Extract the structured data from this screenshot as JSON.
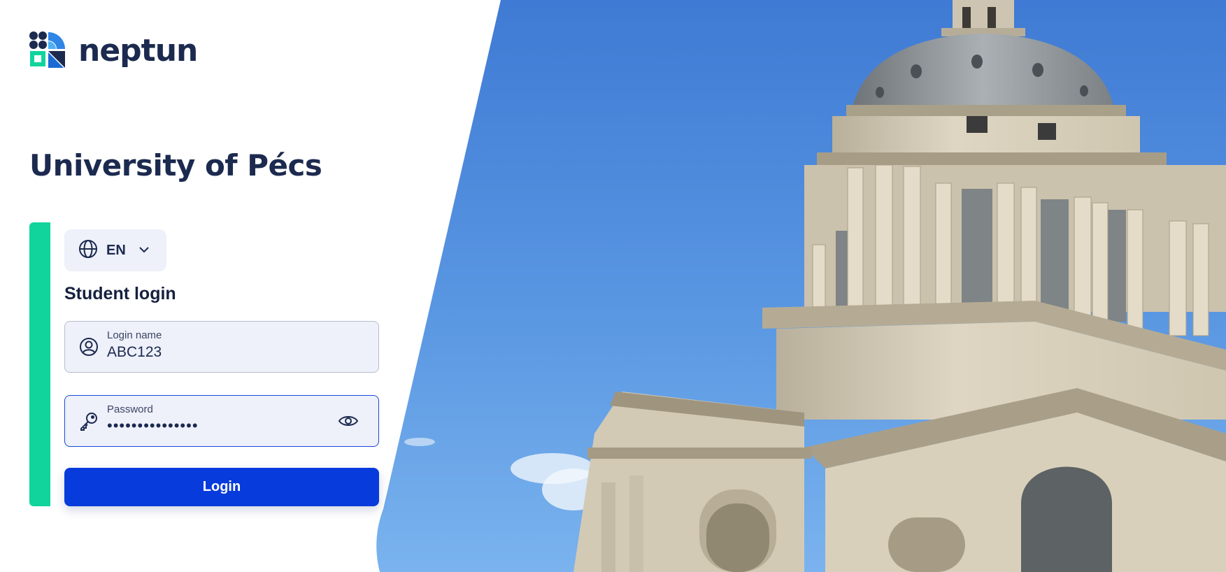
{
  "brand": {
    "name": "neptun"
  },
  "institution": {
    "title": "University of Pécs"
  },
  "language": {
    "code": "EN",
    "icon": "globe-icon",
    "dropdown_icon": "chevron-down-icon"
  },
  "login_form": {
    "title": "Student login",
    "login_name": {
      "label": "Login name",
      "value": "ABC123",
      "icon": "user-circle-icon"
    },
    "password": {
      "label": "Password",
      "value": "•••••••••••••••",
      "icon": "key-icon",
      "toggle_icon": "eye-icon"
    },
    "submit_label": "Login"
  },
  "colors": {
    "brand_dark": "#1c2a4f",
    "accent_green": "#10d49c",
    "primary_blue": "#083bdc",
    "field_bg": "#eef0fa",
    "sky": "#4a86d8"
  }
}
